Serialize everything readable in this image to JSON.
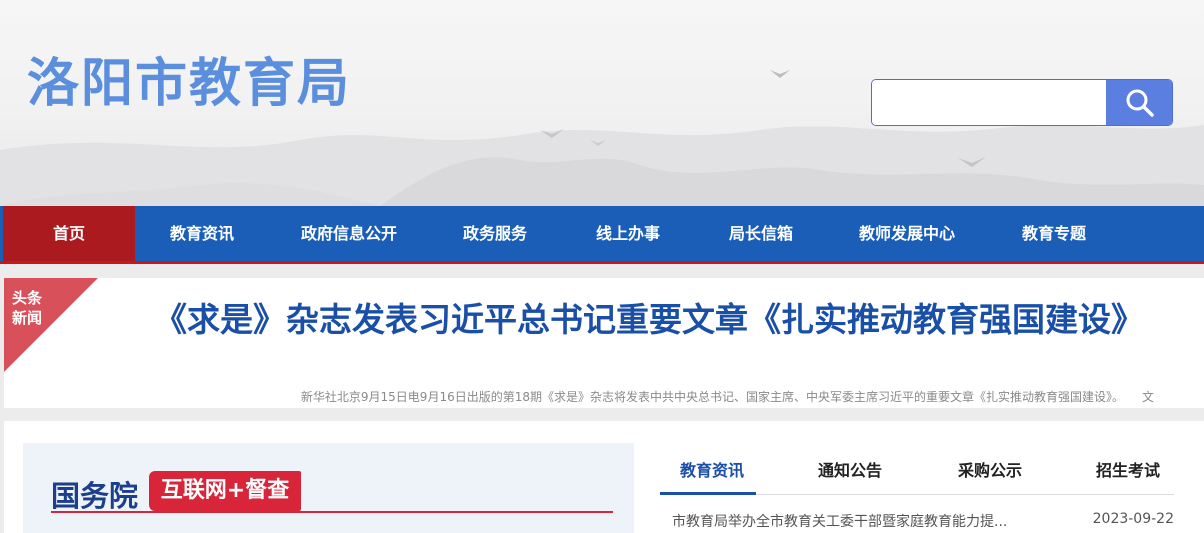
{
  "site": {
    "title": "洛阳市教育局"
  },
  "search": {
    "placeholder": ""
  },
  "nav": {
    "items": [
      {
        "label": "首页",
        "active": true
      },
      {
        "label": "教育资讯"
      },
      {
        "label": "政府信息公开"
      },
      {
        "label": "政务服务"
      },
      {
        "label": "线上办事"
      },
      {
        "label": "局长信箱"
      },
      {
        "label": "教师发展中心"
      },
      {
        "label": "教育专题"
      }
    ]
  },
  "headline": {
    "badge": "头条新闻",
    "title": "《求是》杂志发表习近平总书记重要文章《扎实推动教育强国建设》",
    "summary": "新华社北京9月15日电9月16日出版的第18期《求是》杂志将发表中共中央总书记、国家主席、中央军委主席习近平的重要文章《扎实推动教育强国建设》。　　文"
  },
  "banner": {
    "org": "国务院",
    "tag": "互联网+督查"
  },
  "tabs": [
    {
      "label": "教育资讯",
      "active": true
    },
    {
      "label": "通知公告"
    },
    {
      "label": "采购公示"
    },
    {
      "label": "招生考试"
    }
  ],
  "news": [
    {
      "title": "市教育局举办全市教育关工委干部暨家庭教育能力提...",
      "date": "2023-09-22"
    }
  ],
  "colors": {
    "nav": "#1a5eb8",
    "nav_active": "#aa1a1e",
    "title": "#5b8fdd",
    "headline": "#1a4fa8",
    "accent_red": "#d8253a"
  }
}
